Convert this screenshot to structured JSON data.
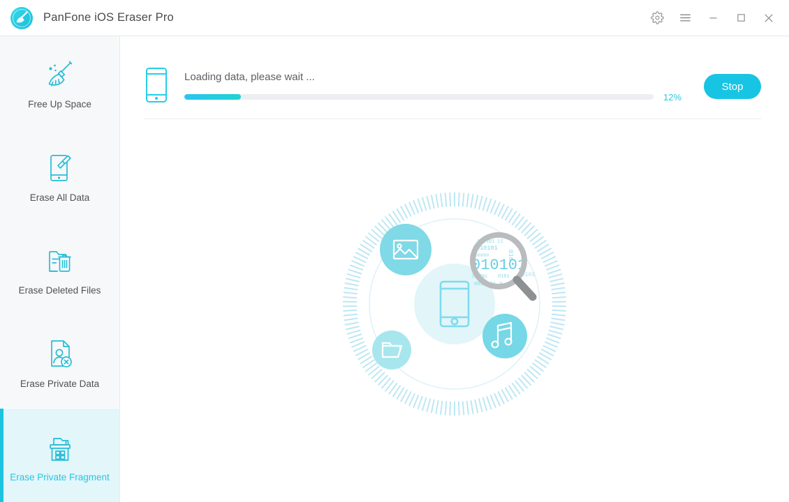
{
  "window": {
    "title": "PanFone iOS Eraser Pro",
    "logo_icon": "broom-circle-logo",
    "controls": [
      {
        "name": "settings-button",
        "icon": "gear-icon"
      },
      {
        "name": "menu-button",
        "icon": "hamburger-menu-icon"
      },
      {
        "name": "minimize-button",
        "icon": "minimize-icon"
      },
      {
        "name": "maximize-button",
        "icon": "maximize-icon"
      },
      {
        "name": "close-button",
        "icon": "close-icon"
      }
    ]
  },
  "sidebar": {
    "items": [
      {
        "label": "Free Up Space",
        "icon": "broom-sparkle-icon",
        "active": false
      },
      {
        "label": "Erase All Data",
        "icon": "phone-eraser-icon",
        "active": false
      },
      {
        "label": "Erase Deleted Files",
        "icon": "folder-trash-icon",
        "active": false
      },
      {
        "label": "Erase Private Data",
        "icon": "document-person-x-icon",
        "active": false
      },
      {
        "label": "Erase Private Fragment",
        "icon": "file-cabinet-icon",
        "active": true
      }
    ]
  },
  "status": {
    "device_icon": "mobile-phone-icon",
    "message": "Loading data, please wait ...",
    "progress_percent": 12,
    "progress_label": "12%",
    "stop_label": "Stop"
  },
  "illustration": {
    "center_icon": "mobile-phone-icon",
    "satellites": [
      {
        "name": "photo-icon"
      },
      {
        "name": "folder-icon"
      },
      {
        "name": "music-note-icon"
      }
    ],
    "magnifier_icon": "magnifying-glass-icon",
    "binary_text": "010101"
  },
  "colors": {
    "accent": "#18c4e3",
    "accent_light": "#e3f6fa",
    "text": "#4a4a4a",
    "sidebar_bg": "#f7f8f9",
    "progress_track": "#eceef2"
  }
}
